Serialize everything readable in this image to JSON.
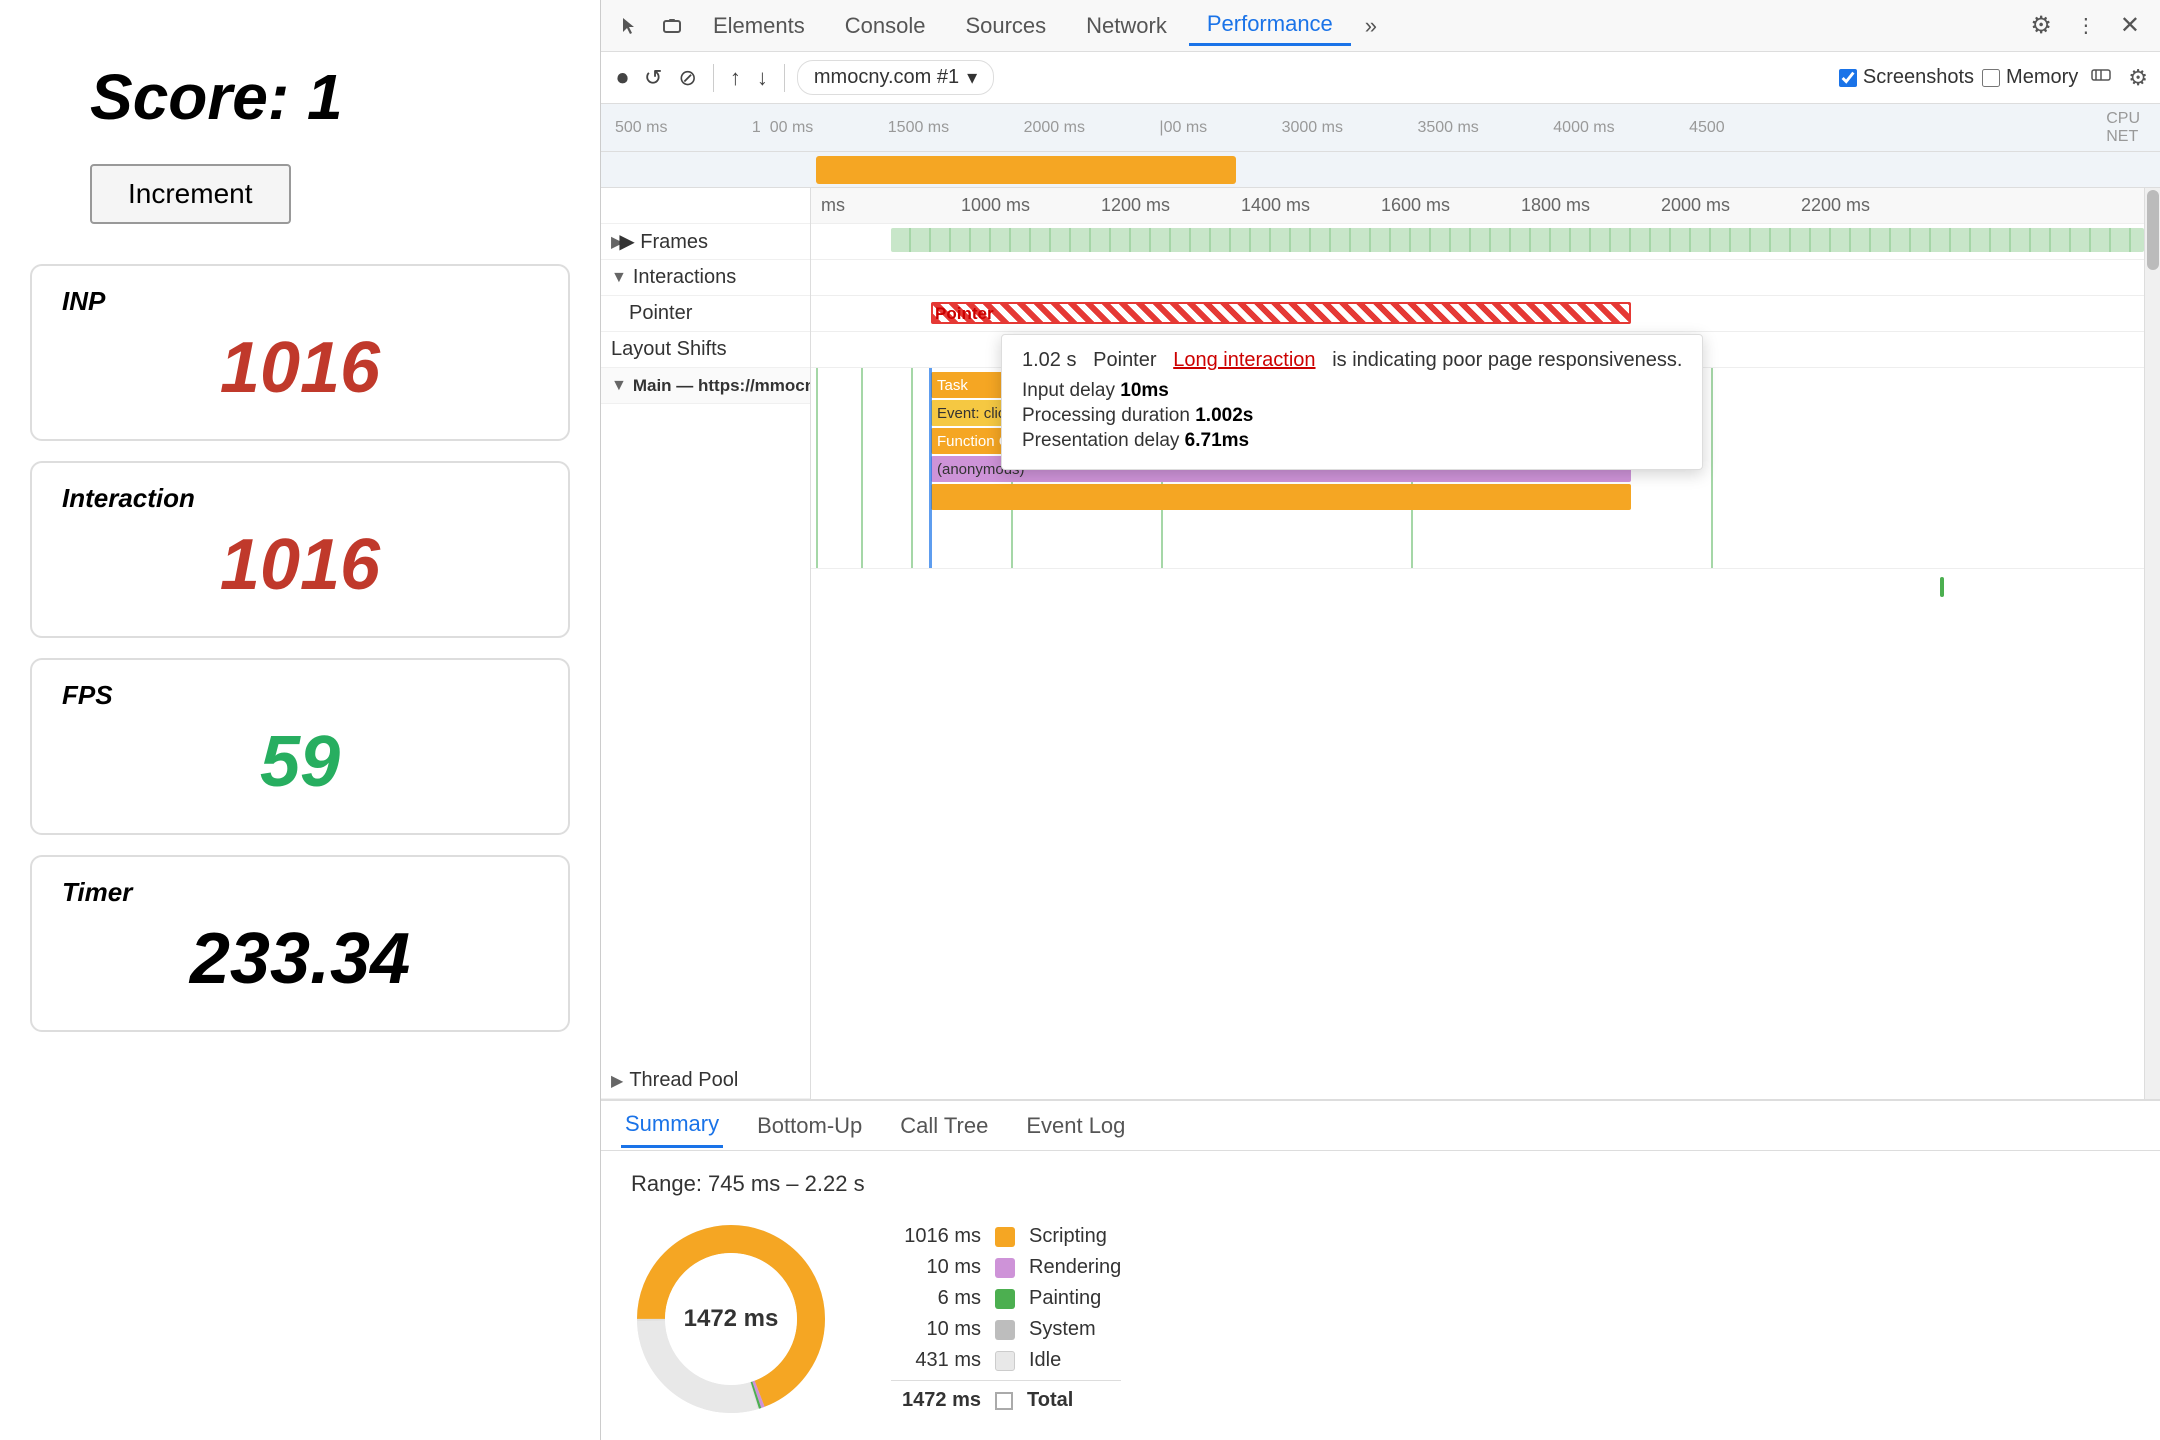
{
  "left": {
    "score_label": "Score:  1",
    "increment_btn": "Increment",
    "inp_label": "INP",
    "inp_value": "1016",
    "interaction_label": "Interaction",
    "interaction_value": "1016",
    "fps_label": "FPS",
    "fps_value": "59",
    "timer_label": "Timer",
    "timer_value": "233.34"
  },
  "devtools": {
    "tabs": [
      "Elements",
      "Console",
      "Sources",
      "Network",
      "Performance",
      "More"
    ],
    "active_tab": "Performance",
    "toolbar": {
      "record_icon": "⏺",
      "reload_icon": "↺",
      "clear_icon": "⊘",
      "upload_icon": "↑",
      "download_icon": "↓",
      "url": "mmocny.com #1",
      "screenshots_label": "Screenshots",
      "memory_label": "Memory",
      "gear_icon": "⚙"
    },
    "ruler": {
      "ticks": [
        "500 ms",
        "1000 ms",
        "1500 ms",
        "2000 ms",
        "3000 ms",
        "3500 ms",
        "4000 ms",
        "4500"
      ]
    },
    "ruler2": {
      "ticks": [
        "ms",
        "1000 ms",
        "1200 ms",
        "1400 ms",
        "1600 ms",
        "1800 ms",
        "2000 ms",
        "2200 ms"
      ]
    },
    "sections": {
      "frames_label": "▶ Frames",
      "interactions_label": "▼ Interactions",
      "pointer_label": "Pointer",
      "layout_shifts_label": "Layout Shifts",
      "main_thread_label": "▼ Main — https://mmocny.co",
      "thread_pool_label": "▶ Thread Pool"
    },
    "task_bars": {
      "task": "Task",
      "event_click": "Event: click",
      "function_call": "Function Call",
      "anonymous": "(anonymous)"
    },
    "tooltip": {
      "time": "1.02 s",
      "type": "Pointer",
      "link_text": "Long interaction",
      "suffix": "is indicating poor page responsiveness.",
      "input_delay_label": "Input delay",
      "input_delay_val": "10ms",
      "processing_duration_label": "Processing duration",
      "processing_duration_val": "1.002s",
      "presentation_delay_label": "Presentation delay",
      "presentation_delay_val": "6.71ms"
    },
    "bottom_tabs": [
      "Summary",
      "Bottom-Up",
      "Call Tree",
      "Event Log"
    ],
    "active_bottom_tab": "Summary",
    "summary": {
      "range": "Range: 745 ms – 2.22 s",
      "donut_center": "1472 ms",
      "legend": [
        {
          "ms": "1016 ms",
          "color": "#f5a623",
          "name": "Scripting"
        },
        {
          "ms": "10 ms",
          "color": "#ce93d8",
          "name": "Rendering"
        },
        {
          "ms": "6 ms",
          "color": "#4caf50",
          "name": "Painting"
        },
        {
          "ms": "10 ms",
          "color": "#bdbdbd",
          "name": "System"
        },
        {
          "ms": "431 ms",
          "color": "#e0e0e0",
          "name": "Idle"
        },
        {
          "ms": "1472 ms",
          "color": "",
          "name": "Total"
        }
      ]
    }
  },
  "icons": {
    "cursor_icon": "⬡",
    "device_icon": "▭",
    "gear": "⚙",
    "dots": "⋮",
    "close": "✕",
    "pencil": "✏"
  }
}
